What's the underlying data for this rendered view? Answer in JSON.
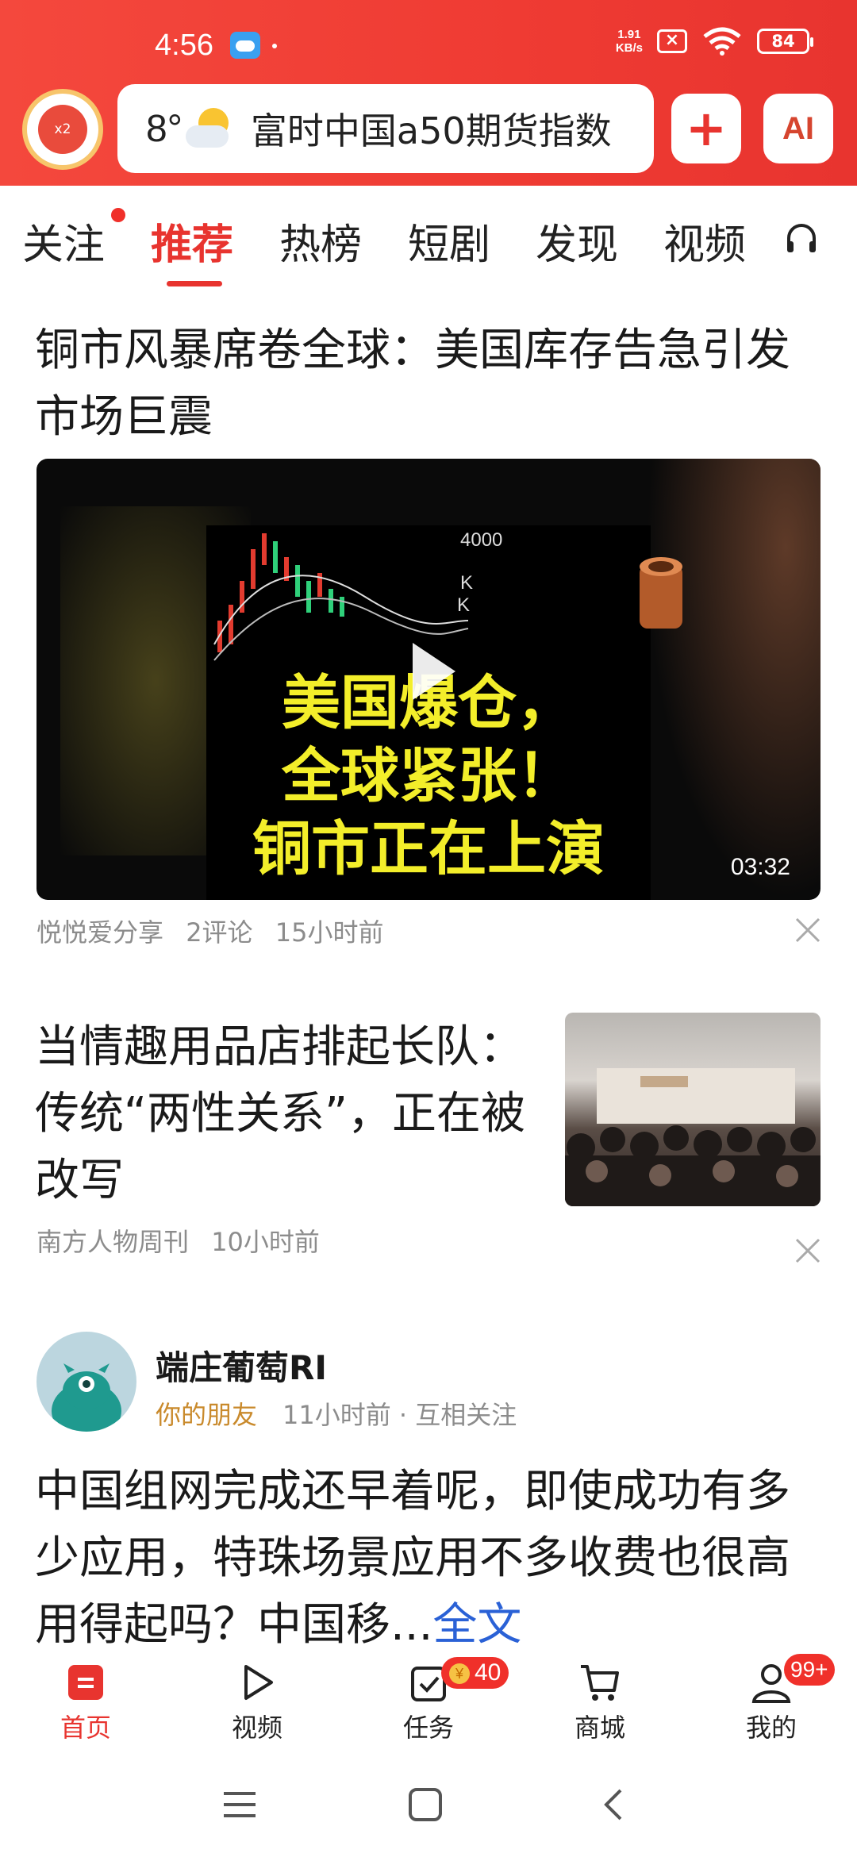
{
  "status_bar": {
    "time": "4:56",
    "net_speed_value": "1.91",
    "net_speed_unit": "KB/s",
    "battery": "84"
  },
  "header": {
    "redpacket_label": "x2",
    "weather_temp": "8°",
    "search_query": "富时中国a50期货指数",
    "ai_label": "AI",
    "plus_label": "+"
  },
  "tabs": [
    {
      "label": "关注"
    },
    {
      "label": "推荐"
    },
    {
      "label": "热榜"
    },
    {
      "label": "短剧"
    },
    {
      "label": "发现"
    },
    {
      "label": "视频"
    }
  ],
  "feed": {
    "article1": {
      "title": "铜市风暴席卷全球：美国库存告急引发市场巨震",
      "overlay_line1": "美国爆仓，",
      "overlay_line2": "全球紧张！",
      "overlay_line3": "铜市正在上演",
      "chart_label": "4000",
      "duration": "03:32",
      "source": "悦悦爱分享",
      "comments": "2评论",
      "time": "15小时前"
    },
    "article2": {
      "title": "当情趣用品店排起长队：传统“两性关系”，正在被改写",
      "source": "南方人物周刊",
      "time": "10小时前"
    },
    "post": {
      "author": "端庄葡萄RI",
      "friend_label": "你的朋友",
      "meta": "11小时前 · 互相关注",
      "text": "中国组网完成还早着呢，即使成功有多少应用，特珠场景应用不多收费也很高用得起吗？中国移...",
      "read_more": "全文"
    }
  },
  "bottom_nav": {
    "items": [
      {
        "label": "首页"
      },
      {
        "label": "视频"
      },
      {
        "label": "任务"
      },
      {
        "label": "商城"
      },
      {
        "label": "我的"
      }
    ],
    "task_badge": "40",
    "profile_badge": "99+"
  },
  "colors": {
    "brand_red": "#e8342f",
    "link_blue": "#2a61d6",
    "friend_gold": "#c98a2c",
    "video_text_yellow": "#f3ee2a"
  }
}
